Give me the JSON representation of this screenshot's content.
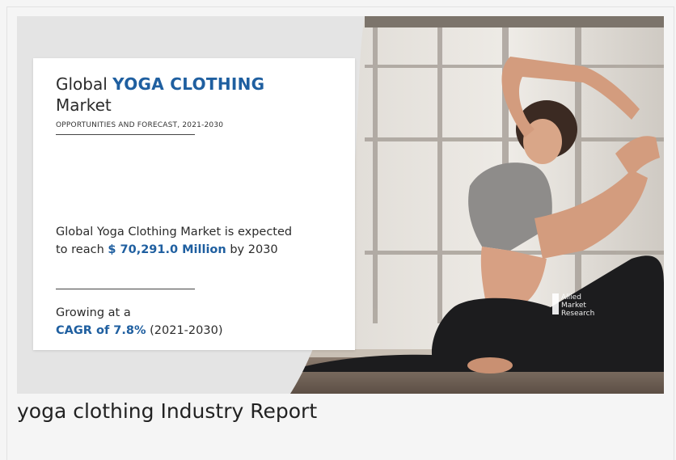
{
  "infographic": {
    "title_prefix": "Global ",
    "title_strong": "YOGA CLOTHING",
    "title_line2": "Market",
    "subtitle": "OPPORTUNITIES AND FORECAST, 2021-2030",
    "stat_prefix": "Global Yoga Clothing Market is expected to reach ",
    "stat_value": "$ 70,291.0 Million",
    "stat_suffix": " by 2030",
    "cagr_prefix": "Growing at a",
    "cagr_value": "CAGR of 7.8%",
    "cagr_suffix": " (2021-2030)",
    "logo_line1": "Allied",
    "logo_line2": "Market",
    "logo_line3": "Research",
    "accent_color": "#1f5fa0"
  },
  "caption": "yoga clothing Industry Report"
}
